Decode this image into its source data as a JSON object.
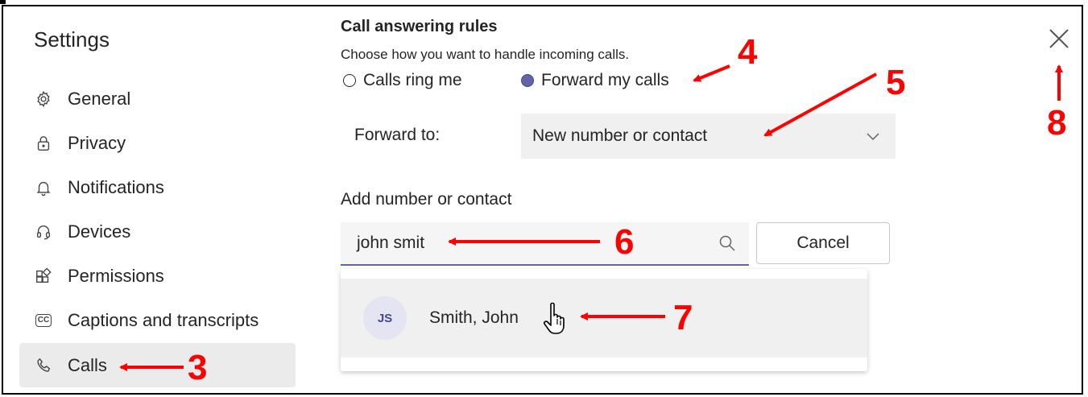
{
  "sidebar": {
    "title": "Settings",
    "items": [
      {
        "label": "General",
        "icon": "gear-icon"
      },
      {
        "label": "Privacy",
        "icon": "lock-icon"
      },
      {
        "label": "Notifications",
        "icon": "bell-icon"
      },
      {
        "label": "Devices",
        "icon": "headset-icon"
      },
      {
        "label": "Permissions",
        "icon": "apps-icon"
      },
      {
        "label": "Captions and transcripts",
        "icon": "cc-icon",
        "glyph": "CC"
      },
      {
        "label": "Calls",
        "icon": "phone-icon",
        "active": true
      }
    ]
  },
  "main": {
    "title": "Call answering rules",
    "subtitle": "Choose how you want to handle incoming calls.",
    "radio_calls_ring": "Calls ring me",
    "radio_forward": "Forward my calls",
    "selected_radio": "Forward my calls",
    "forward_label": "Forward to:",
    "forward_value": "New number or contact",
    "add_label": "Add number or contact",
    "search_value": "john smit",
    "cancel_label": "Cancel",
    "suggestion": {
      "initials": "JS",
      "name": "Smith, John"
    }
  },
  "annotations": [
    "3",
    "4",
    "5",
    "6",
    "7",
    "8"
  ],
  "colors": {
    "accent": "#6264a7",
    "annotation": "#ff0000",
    "selected_bg": "#ebebeb"
  }
}
